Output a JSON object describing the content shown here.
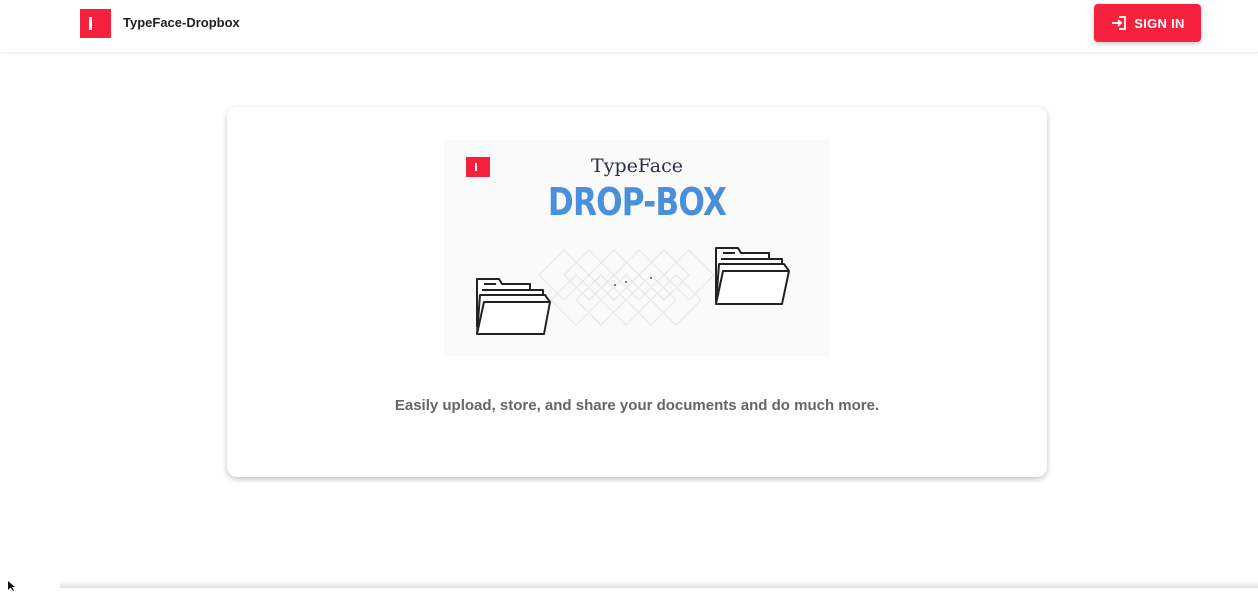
{
  "header": {
    "app_title": "TypeFace-Dropbox",
    "logo_icon": "typeface-logo-icon",
    "sign_in_label": "SIGN IN",
    "sign_in_icon": "login-icon"
  },
  "hero": {
    "brand": "TypeFace",
    "product": "DROP-BOX",
    "logo_icon": "typeface-logo-icon",
    "illustration_icons": [
      "folder-icon",
      "folder-icon"
    ]
  },
  "card": {
    "tagline": "Easily upload, store, and share your documents and do much more."
  },
  "colors": {
    "accent": "#f5213e",
    "hero_title": "#4a8fdc",
    "tagline": "#666666"
  }
}
